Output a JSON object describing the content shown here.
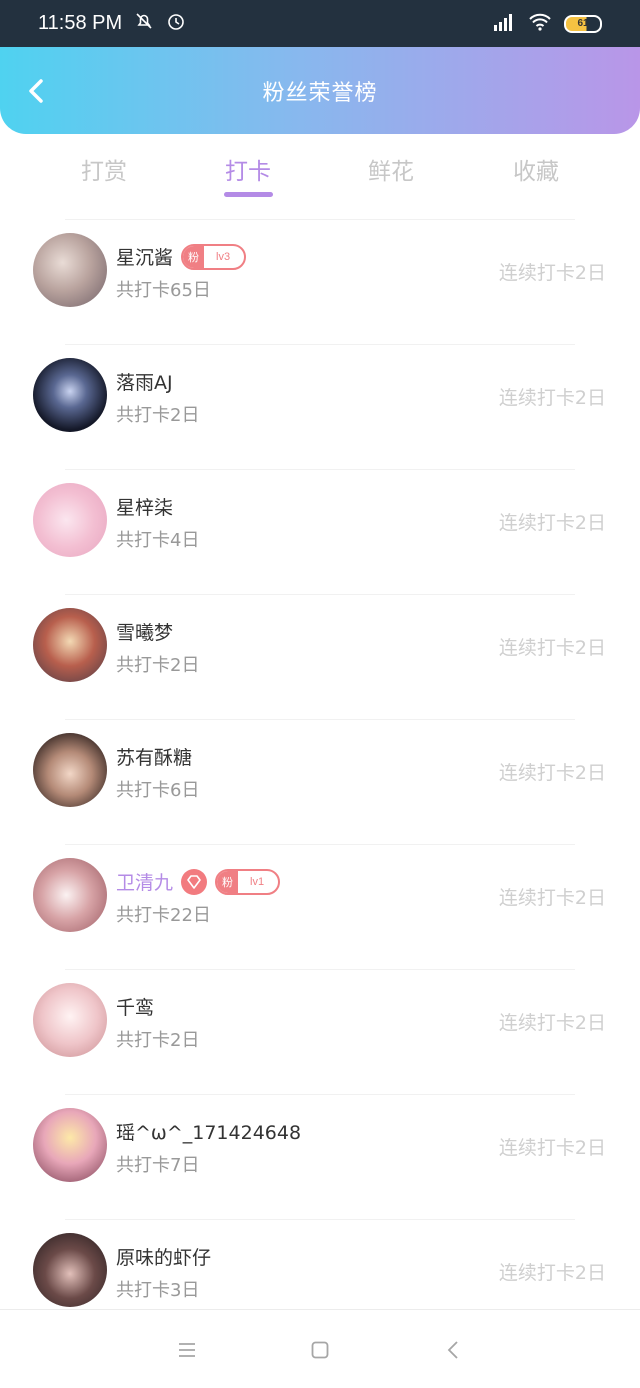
{
  "status": {
    "time": "11:58 PM",
    "battery": "61"
  },
  "header": {
    "title": "粉丝荣誉榜"
  },
  "tabs": [
    {
      "label": "打赏"
    },
    {
      "label": "打卡"
    },
    {
      "label": "鲜花"
    },
    {
      "label": "收藏"
    }
  ],
  "active_tab": "打卡",
  "rows": [
    {
      "name": "星沉酱",
      "sub": "共打卡65日",
      "streak": "连续打卡2日",
      "badge_left": "粉",
      "badge_right": "lv3"
    },
    {
      "name": "落雨AJ",
      "sub": "共打卡2日",
      "streak": "连续打卡2日"
    },
    {
      "name": "星梓柒",
      "sub": "共打卡4日",
      "streak": "连续打卡2日"
    },
    {
      "name": "雪曦梦",
      "sub": "共打卡2日",
      "streak": "连续打卡2日"
    },
    {
      "name": "苏有酥糖",
      "sub": "共打卡6日",
      "streak": "连续打卡2日"
    },
    {
      "name": "卫清九",
      "sub": "共打卡22日",
      "streak": "连续打卡2日",
      "badge_left": "粉",
      "badge_right": "lv1"
    },
    {
      "name": "千鸾",
      "sub": "共打卡2日",
      "streak": "连续打卡2日"
    },
    {
      "name": "瑶^ω^_171424648",
      "sub": "共打卡7日",
      "streak": "连续打卡2日"
    },
    {
      "name": "原味的虾仔",
      "sub": "共打卡3日",
      "streak": "连续打卡2日"
    }
  ],
  "colors": {
    "accent": "#b48be6",
    "badge": "#f07f84",
    "muted": "#cfcfcf"
  }
}
